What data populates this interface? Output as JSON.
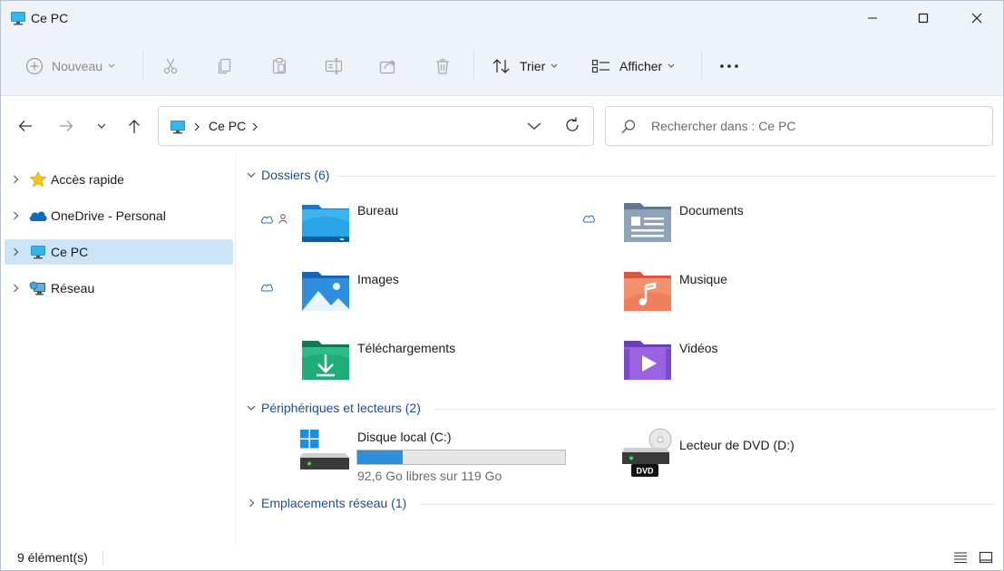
{
  "window": {
    "title": "Ce PC"
  },
  "toolbar": {
    "new_label": "Nouveau",
    "sort_label": "Trier",
    "view_label": "Afficher",
    "more_label": "..."
  },
  "address": {
    "location": "Ce PC"
  },
  "search": {
    "placeholder": "Rechercher dans : Ce PC"
  },
  "sidebar": {
    "items": [
      {
        "label": "Accès rapide",
        "icon": "star-icon"
      },
      {
        "label": "OneDrive - Personal",
        "icon": "cloud-icon"
      },
      {
        "label": "Ce PC",
        "icon": "computer-icon",
        "selected": true
      },
      {
        "label": "Réseau",
        "icon": "network-icon"
      }
    ]
  },
  "groups": {
    "folders_label": "Dossiers (6)",
    "devices_label": "Périphériques et lecteurs (2)",
    "network_label": "Emplacements réseau (1)"
  },
  "folders": [
    {
      "name": "Bureau",
      "icon": "desktop-folder-icon"
    },
    {
      "name": "Documents",
      "icon": "documents-folder-icon"
    },
    {
      "name": "Images",
      "icon": "pictures-folder-icon"
    },
    {
      "name": "Musique",
      "icon": "music-folder-icon"
    },
    {
      "name": "Téléchargements",
      "icon": "downloads-folder-icon"
    },
    {
      "name": "Vidéos",
      "icon": "videos-folder-icon"
    }
  ],
  "drives": [
    {
      "name": "Disque local (C:)",
      "free_text": "92,6 Go libres sur 119 Go",
      "used_fraction": 0.22
    },
    {
      "name": "Lecteur de DVD (D:)",
      "badge": "DVD"
    }
  ],
  "statusbar": {
    "count": "9 élément(s)"
  },
  "colors": {
    "accent": "#2f8fdb",
    "group_header": "#1f4e8c",
    "selection": "#cce4f7",
    "chrome": "#eef3f9"
  }
}
